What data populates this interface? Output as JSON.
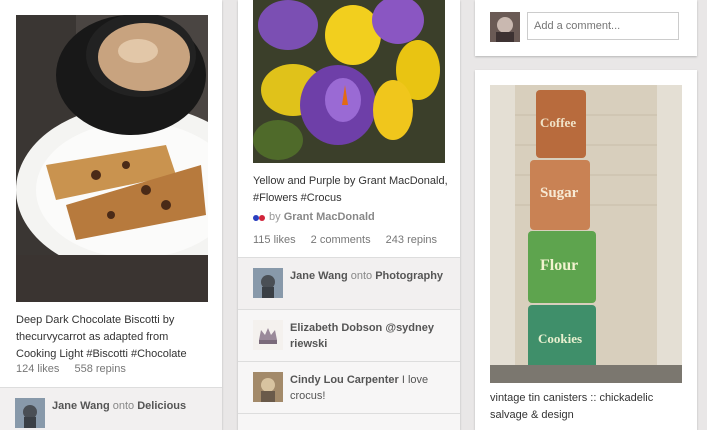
{
  "pins": [
    {
      "caption": "Deep Dark Chocolate Biscotti by thecurvycarrot as adapted from Cooking Light #Biscotti #Chocolate",
      "likes": "124 likes",
      "repins": "558 repins",
      "activity": [
        {
          "user": "Jane Wang",
          "onto": "onto",
          "board": "Delicious"
        }
      ]
    },
    {
      "caption": "Yellow and Purple by Grant MacDonald, #Flowers #Crocus",
      "by_prefix": "by",
      "by_user": "Grant MacDonald",
      "likes": "115 likes",
      "comments": "2 comments",
      "repins": "243 repins",
      "activity": [
        {
          "user": "Jane Wang",
          "onto": "onto",
          "board": "Photography"
        },
        {
          "user": "Elizabeth Dobson @sydney riewski",
          "text": ""
        },
        {
          "user": "Cindy Lou Carpenter",
          "text": "I love crocus!"
        }
      ]
    },
    {
      "comment_placeholder": "Add a comment...",
      "caption": "vintage tin canisters :: chickadelic salvage & design"
    }
  ],
  "canister_labels": [
    "Coffee",
    "Sugar",
    "Flour",
    "Cookies"
  ]
}
